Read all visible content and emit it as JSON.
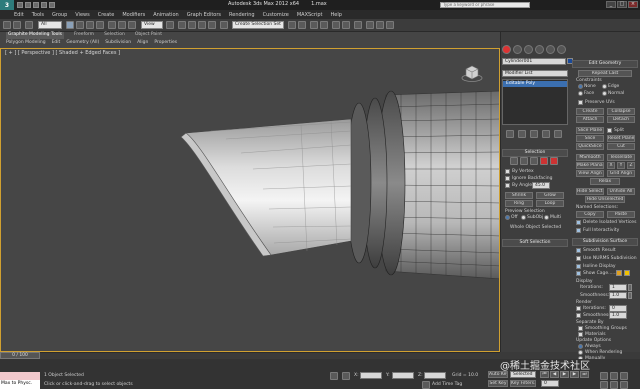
{
  "titlebar": {
    "logo": "3",
    "app_title": "Autodesk 3ds Max 2012 x64",
    "file_name": "1.max",
    "search_placeholder": "Type a keyword or phrase",
    "min": "_",
    "max": "□",
    "close": "×"
  },
  "menubar": {
    "items": [
      "Edit",
      "Tools",
      "Group",
      "Views",
      "Create",
      "Modifiers",
      "Animation",
      "Graph Editors",
      "Rendering",
      "Customize",
      "MAXScript",
      "Help"
    ]
  },
  "toolbar": {
    "selection_filter": "All",
    "ref_coord": "View",
    "named_selection": "Create Selection Set"
  },
  "ribbon": {
    "tabs": [
      "Graphite Modeling Tools",
      "Freeform",
      "Selection",
      "Object Paint"
    ],
    "panels": [
      "Polygon Modeling",
      "Edit",
      "Geometry (All)",
      "Subdivision",
      "Align",
      "Properties"
    ]
  },
  "viewport": {
    "label": "[ + ] [ Perspective ] [ Shaded + Edged Faces ]"
  },
  "command_panel": {
    "object_name": "Cylinder001",
    "modifier_list": "Modifier List",
    "stack_item": "Editable Poly",
    "selection": {
      "header": "Selection",
      "by_vertex": "By Vertex",
      "ignore_backfacing": "Ignore Backfacing",
      "by_angle": "By Angle:",
      "by_angle_value": "45.0",
      "shrink": "Shrink",
      "grow": "Grow",
      "ring": "Ring",
      "loop": "Loop",
      "preview_selection": "Preview Selection",
      "preview_off": "Off",
      "subobj": "SubObj",
      "multi": "Multi",
      "status": "Whole Object Selected"
    },
    "soft_selection": {
      "header": "Soft Selection"
    },
    "edit_geometry": {
      "header": "Edit Geometry",
      "repeat_last": "Repeat Last",
      "constraints": "Constraints",
      "none": "None",
      "edge": "Edge",
      "face": "Face",
      "normal": "Normal",
      "preserve_uvs": "Preserve UVs",
      "create": "Create",
      "collapse": "Collapse",
      "attach": "Attach",
      "detach": "Detach",
      "slice_plane": "Slice Plane",
      "split": "Split",
      "slice": "Slice",
      "reset_plane": "Reset Plane",
      "quickslice": "QuickSlice",
      "cut": "Cut",
      "msmooth": "MSmooth",
      "tessellate": "Tessellate",
      "make_planar": "Make Planar",
      "x": "X",
      "y": "Y",
      "z": "Z",
      "view_align": "View Align",
      "grid_align": "Grid Align",
      "relax": "Relax",
      "hide_selected": "Hide Selected",
      "unhide_all": "Unhide All",
      "hide_unselected": "Hide Unselected",
      "named_selections": "Named Selections:",
      "copy": "Copy",
      "paste": "Paste",
      "delete_isolated": "Delete Isolated Vertices",
      "full_interactivity": "Full Interactivity"
    },
    "subdivision_surface": {
      "header": "Subdivision Surface",
      "smooth_result": "Smooth Result",
      "use_nurms": "Use NURMS Subdivision",
      "isoline_display": "Isoline Display",
      "show_cage": "Show Cage......",
      "cage_color_1": "#e0a020",
      "cage_color_2": "#f0c000",
      "display": "Display",
      "iterations": "Iterations:",
      "iterations_value": "1",
      "smoothness": "Smoothness:",
      "smoothness_value": "1.0",
      "render": "Render",
      "render_iterations_value": "0",
      "render_smoothness_value": "1.0",
      "separate_by": "Separate By",
      "smoothing_groups": "Smoothing Groups",
      "materials": "Materials",
      "update_options": "Update Options",
      "always": "Always",
      "when_rendering": "When Rendering",
      "manually": "Manually"
    }
  },
  "timeline": {
    "slider": "0 / 100"
  },
  "status": {
    "maxscript": "Max to Physc.",
    "objects_selected": "1 Object Selected",
    "prompt": "Click or click-and-drag to select objects",
    "x_label": "X:",
    "y_label": "Y:",
    "z_label": "Z:",
    "grid": "Grid = 10.0",
    "auto_key": "Auto Key",
    "selected": "Selected",
    "set_key": "Set Key",
    "key_filters": "Key Filters...",
    "add_time_tag": "Add Time Tag",
    "frame": "0"
  },
  "watermark": "@稀土掘金技术社区"
}
